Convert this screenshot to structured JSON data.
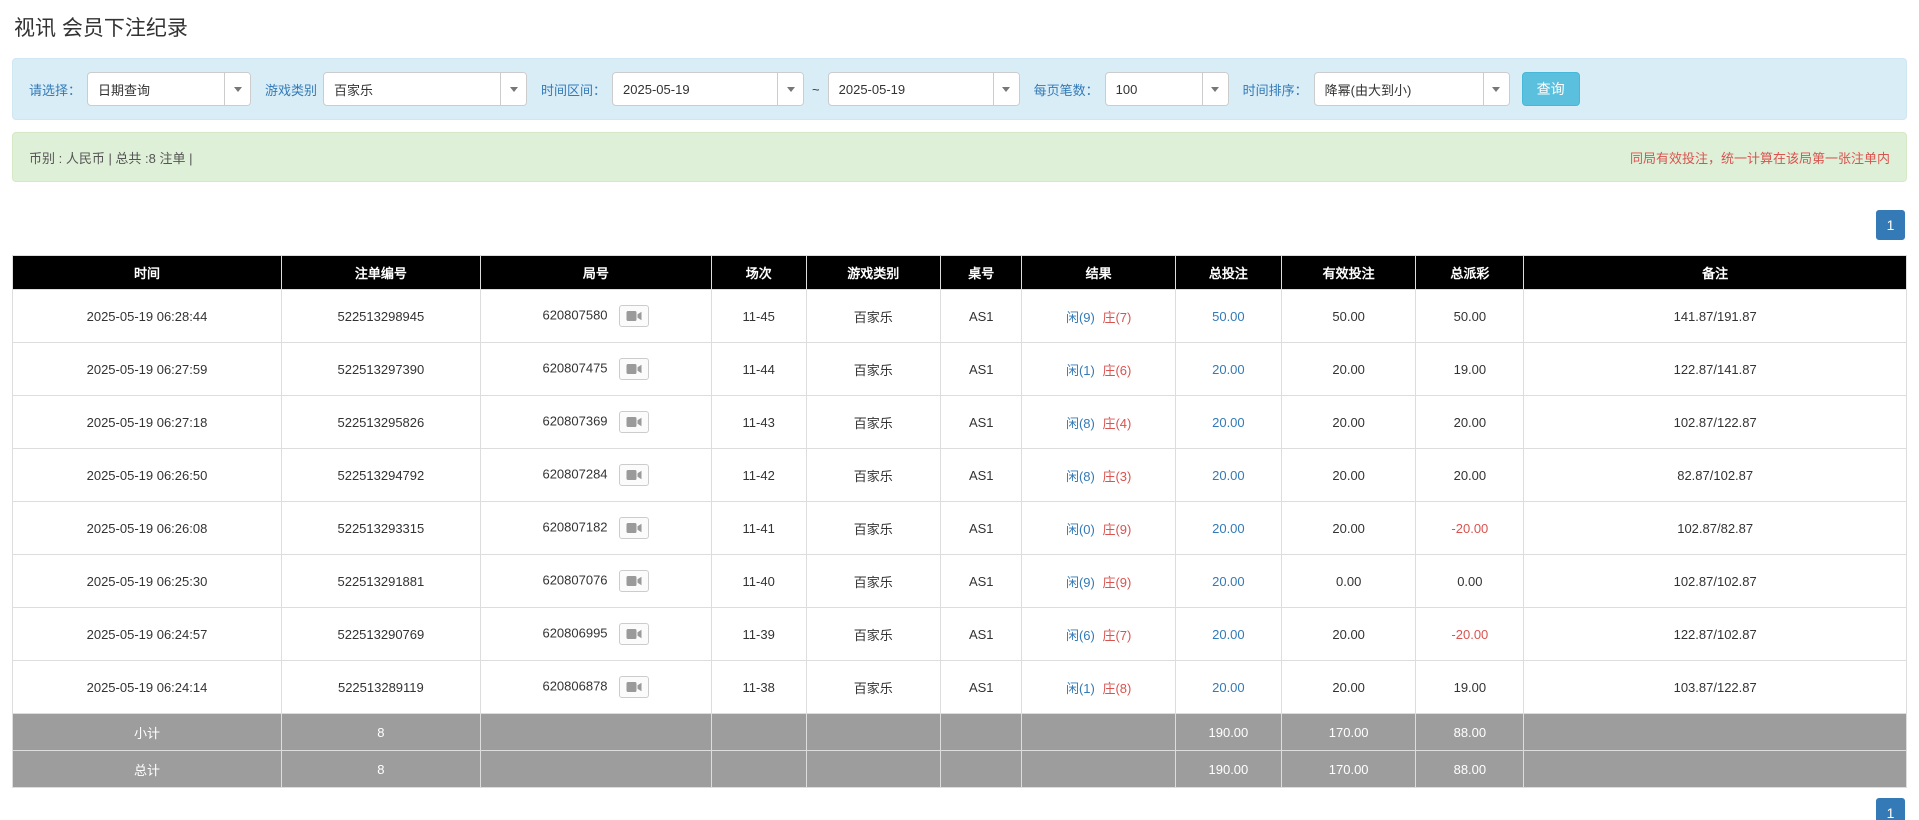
{
  "page": {
    "title": "视讯 会员下注纪录"
  },
  "filters": {
    "select_label": "请选择：",
    "select_value": "日期查询",
    "game_label": "游戏类别",
    "game_value": "百家乐",
    "range_label": "时间区间：",
    "date_from": "2025-05-19",
    "range_separator": "~",
    "date_to": "2025-05-19",
    "page_size_label": "每页笔数：",
    "page_size_value": "100",
    "sort_label": "时间排序：",
    "sort_value": "降幂(由大到小)",
    "search_label": "查询"
  },
  "summary": {
    "info": "币别 : 人民币 | 总共 :8 注单 |",
    "warning": "同局有效投注，统一计算在该局第一张注单内"
  },
  "pagination": {
    "current_page": "1"
  },
  "table": {
    "headers": [
      "时间",
      "注单编号",
      "局号",
      "场次",
      "游戏类别",
      "桌号",
      "结果",
      "总投注",
      "有效投注",
      "总派彩",
      "备注"
    ],
    "rows": [
      {
        "time": "2025-05-19 06:28:44",
        "bet_id": "522513298945",
        "round_id": "620807580",
        "session": "11-45",
        "game": "百家乐",
        "table_no": "AS1",
        "result_player": "闲(9)",
        "result_banker": "庄(7)",
        "total_bet": "50.00",
        "valid_bet": "50.00",
        "payout": "50.00",
        "note": "141.87/191.87"
      },
      {
        "time": "2025-05-19 06:27:59",
        "bet_id": "522513297390",
        "round_id": "620807475",
        "session": "11-44",
        "game": "百家乐",
        "table_no": "AS1",
        "result_player": "闲(1)",
        "result_banker": "庄(6)",
        "total_bet": "20.00",
        "valid_bet": "20.00",
        "payout": "19.00",
        "note": "122.87/141.87"
      },
      {
        "time": "2025-05-19 06:27:18",
        "bet_id": "522513295826",
        "round_id": "620807369",
        "session": "11-43",
        "game": "百家乐",
        "table_no": "AS1",
        "result_player": "闲(8)",
        "result_banker": "庄(4)",
        "total_bet": "20.00",
        "valid_bet": "20.00",
        "payout": "20.00",
        "note": "102.87/122.87"
      },
      {
        "time": "2025-05-19 06:26:50",
        "bet_id": "522513294792",
        "round_id": "620807284",
        "session": "11-42",
        "game": "百家乐",
        "table_no": "AS1",
        "result_player": "闲(8)",
        "result_banker": "庄(3)",
        "total_bet": "20.00",
        "valid_bet": "20.00",
        "payout": "20.00",
        "note": "82.87/102.87"
      },
      {
        "time": "2025-05-19 06:26:08",
        "bet_id": "522513293315",
        "round_id": "620807182",
        "session": "11-41",
        "game": "百家乐",
        "table_no": "AS1",
        "result_player": "闲(0)",
        "result_banker": "庄(9)",
        "total_bet": "20.00",
        "valid_bet": "20.00",
        "payout": "-20.00",
        "note": "102.87/82.87"
      },
      {
        "time": "2025-05-19 06:25:30",
        "bet_id": "522513291881",
        "round_id": "620807076",
        "session": "11-40",
        "game": "百家乐",
        "table_no": "AS1",
        "result_player": "闲(9)",
        "result_banker": "庄(9)",
        "total_bet": "20.00",
        "valid_bet": "0.00",
        "payout": "0.00",
        "note": "102.87/102.87"
      },
      {
        "time": "2025-05-19 06:24:57",
        "bet_id": "522513290769",
        "round_id": "620806995",
        "session": "11-39",
        "game": "百家乐",
        "table_no": "AS1",
        "result_player": "闲(6)",
        "result_banker": "庄(7)",
        "total_bet": "20.00",
        "valid_bet": "20.00",
        "payout": "-20.00",
        "note": "122.87/102.87"
      },
      {
        "time": "2025-05-19 06:24:14",
        "bet_id": "522513289119",
        "round_id": "620806878",
        "session": "11-38",
        "game": "百家乐",
        "table_no": "AS1",
        "result_player": "闲(1)",
        "result_banker": "庄(8)",
        "total_bet": "20.00",
        "valid_bet": "20.00",
        "payout": "19.00",
        "note": "103.87/122.87"
      }
    ],
    "subtotal": {
      "label": "小计",
      "count": "8",
      "total_bet": "190.00",
      "valid_bet": "170.00",
      "payout": "88.00"
    },
    "grand_total": {
      "label": "总计",
      "count": "8",
      "total_bet": "190.00",
      "valid_bet": "170.00",
      "payout": "88.00"
    }
  },
  "colors": {
    "accent_blue": "#337ab7",
    "result_player_blue": "#337ab7",
    "result_banker_red": "#d9534f",
    "negative_red": "#d9534f",
    "warning_red": "#d9534f",
    "search_button_blue": "#5bc0de",
    "filter_bar_bg": "#d9edf7",
    "summary_bar_bg": "#dff0d8",
    "table_header_bg": "#000000",
    "table_footer_bg": "#9d9d9d"
  },
  "icons": {
    "video_button": "video-camera-icon",
    "dropdown_caret": "chevron-down-icon"
  }
}
